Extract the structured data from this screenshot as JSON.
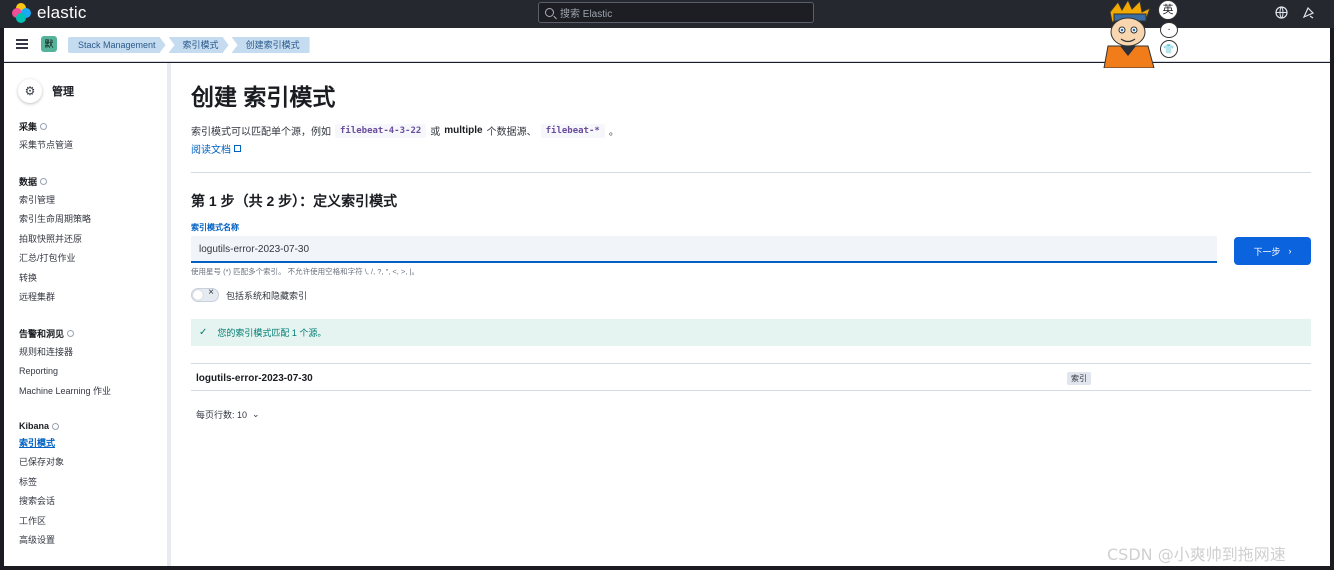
{
  "header": {
    "brand": "elastic",
    "search_placeholder": "搜索 Elastic"
  },
  "mascot": {
    "badge_top": "英",
    "badge_mid": "·",
    "badge_bottom": "👕"
  },
  "subheader": {
    "space_badge": "默",
    "breadcrumbs": [
      "Stack Management",
      "索引模式",
      "创建索引模式"
    ]
  },
  "sidebar": {
    "title": "管理",
    "groups": [
      {
        "heading": "采集",
        "items": [
          "采集节点管道"
        ]
      },
      {
        "heading": "数据",
        "items": [
          "索引管理",
          "索引生命周期策略",
          "拍取快照并还原",
          "汇总/打包作业",
          "转换",
          "远程集群"
        ]
      },
      {
        "heading": "告警和洞见",
        "items": [
          "规则和连接器",
          "Reporting",
          "Machine Learning 作业"
        ]
      },
      {
        "heading": "Kibana",
        "items": [
          "索引模式",
          "已保存对象",
          "标签",
          "搜索会话",
          "工作区",
          "高级设置"
        ]
      }
    ]
  },
  "main": {
    "title": "创建 索引模式",
    "desc_pre": "索引模式可以匹配单个源，例如",
    "desc_code1": "filebeat-4-3-22",
    "desc_mid1": "或",
    "desc_bold": "multiple",
    "desc_mid2": "个数据源、",
    "desc_code2": "filebeat-*",
    "desc_end": "。",
    "doc_link": "阅读文档",
    "step_title": "第 1 步（共 2 步）：定义索引模式",
    "field_label": "索引模式名称",
    "input_value": "logutils-error-2023-07-30",
    "next_button": "下一步",
    "help_text": "使用星号 (*) 匹配多个索引。 不允许使用空格和字符 \\, /, ?, \", <, >, |。",
    "toggle_label": "包括系统和隐藏索引",
    "callout": "您的索引模式匹配 1 个源。",
    "table_rows": [
      {
        "name": "logutils-error-2023-07-30",
        "badge": "索引"
      }
    ],
    "rows_per_page": "每页行数: 10"
  },
  "watermark": "CSDN @小爽帅到拖网速",
  "colors": {
    "accent": "#0b64dd",
    "header_bg": "#25282f",
    "success_bg": "#e6f4f1"
  }
}
